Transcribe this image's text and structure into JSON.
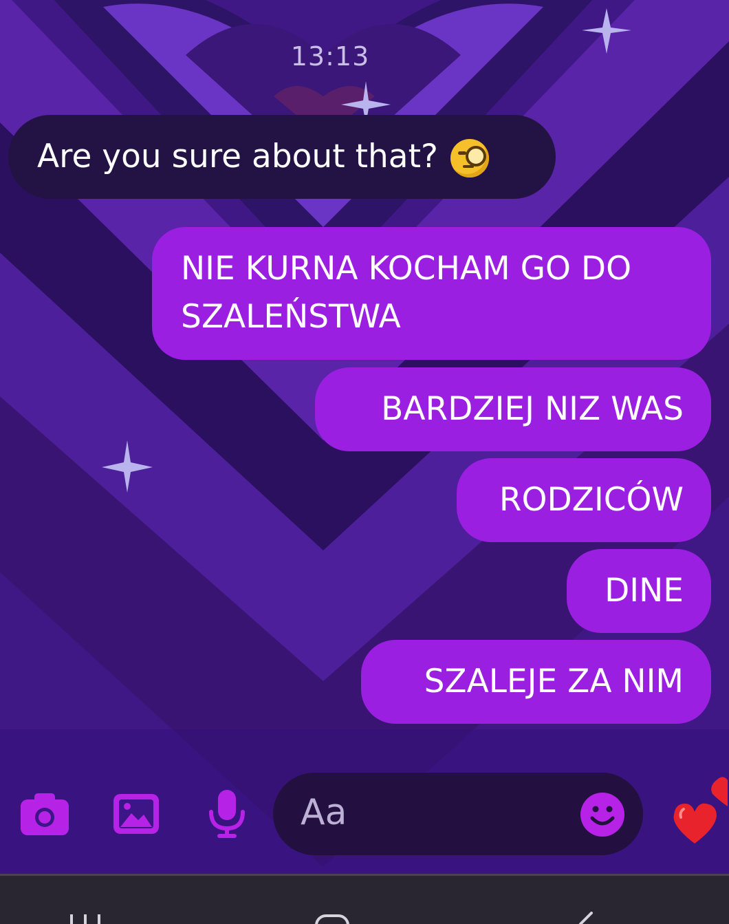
{
  "chat": {
    "timestamp": "13:13",
    "incoming": {
      "text": "Are you sure about that?",
      "emoji": "face-with-monocle"
    },
    "outgoing": [
      "NIE KURNA KOCHAM GO DO\nSZALEŃSTWA",
      "BARDZIEJ NIZ WAS",
      "RODZICÓW",
      "DINE",
      "SZALEJE ZA NIM"
    ]
  },
  "composer": {
    "placeholder": "Aa",
    "icons": [
      "camera-icon",
      "gallery-icon",
      "microphone-icon",
      "smiley-icon",
      "heart-icon"
    ]
  },
  "colors": {
    "outgoing_bubble": "#9a1fe0",
    "incoming_bubble": "#231345",
    "accent_icon": "#b623e6",
    "heart": "#e8232c"
  }
}
